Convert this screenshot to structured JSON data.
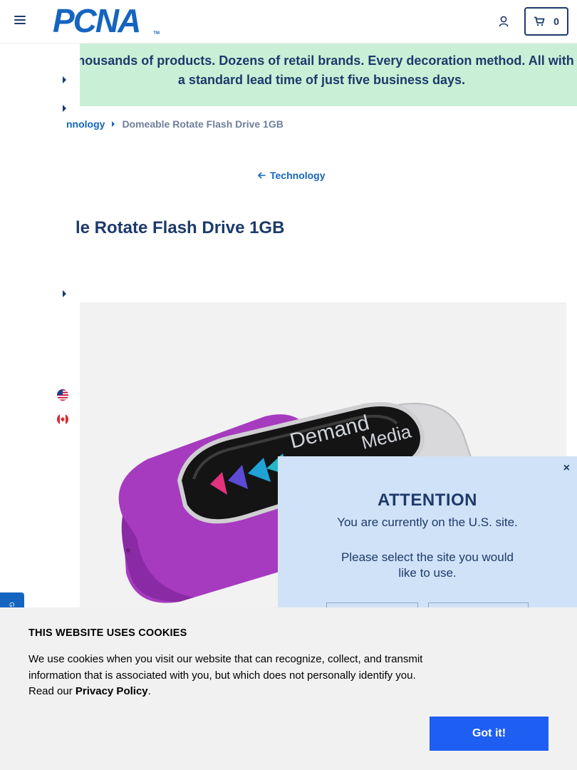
{
  "header": {
    "logo_text": "PCNA",
    "logo_tm": "TM",
    "cart_count": "0"
  },
  "banner": {
    "text": "Thousands of products. Dozens of retail brands. Every decoration method. All with a standard lead time of just five business days."
  },
  "breadcrumb": {
    "parent": "nnology",
    "current": "Domeable Rotate Flash Drive 1GB"
  },
  "back_link": "Technology",
  "product": {
    "title": "le Rotate Flash Drive 1GB",
    "print_text": "Demand Media"
  },
  "attention": {
    "title": "ATTENTION",
    "line1": "You are currently on the U.S. site.",
    "line2": "Please select the site you would like to use.",
    "close": "×"
  },
  "feedback_tab": "G",
  "cookie": {
    "title": "THIS WEBSITE USES COOKIES",
    "text": "We use cookies when you visit our website that can recognize, collect, and transmit information that is associated with you, but which does not personally identify you. Read our",
    "link": "Privacy Policy",
    "period": ".",
    "button": "Got it!"
  },
  "colors": {
    "brand_blue": "#1565c0",
    "navy": "#1d3a6b",
    "banner_green": "#c9f0d6",
    "popup_blue": "#d0e2f7",
    "cookie_button": "#1e5ef3",
    "drive_purple": "#a63bbf"
  }
}
